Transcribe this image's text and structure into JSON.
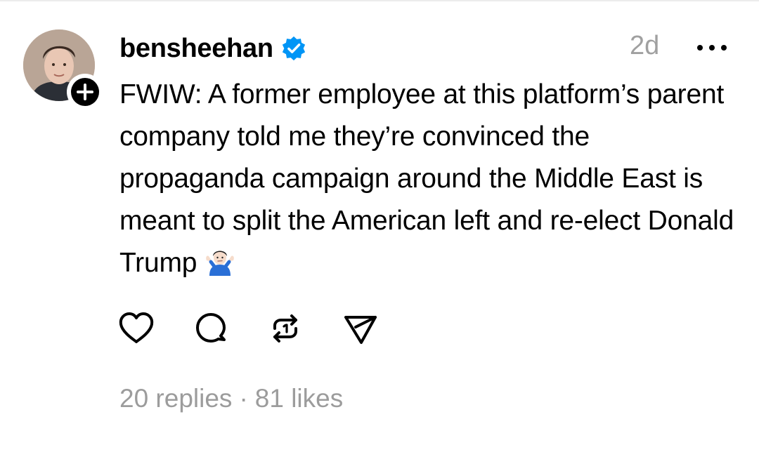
{
  "post": {
    "author": {
      "username": "bensheehan",
      "verified": true,
      "avatar_icon": "avatar-photo",
      "follow_icon": "plus-icon"
    },
    "timestamp": "2d",
    "more_icon": "more-dots-icon",
    "text": "FWIW: A former employee at this platform’s parent company told me they’re convinced the propaganda campaign around the Middle East is meant to split the American left and re-elect Donald Trump",
    "emoji": "person-shrugging-emoji",
    "actions": [
      {
        "name": "like",
        "icon": "heart-icon"
      },
      {
        "name": "reply",
        "icon": "comment-icon"
      },
      {
        "name": "repost",
        "icon": "repost-icon"
      },
      {
        "name": "share",
        "icon": "send-icon"
      }
    ],
    "stats": {
      "replies": "20 replies",
      "separator": "·",
      "likes": "81 likes"
    }
  },
  "colors": {
    "verified_blue": "#0095f6",
    "muted_text": "#9c9c9c",
    "text": "#000000"
  }
}
